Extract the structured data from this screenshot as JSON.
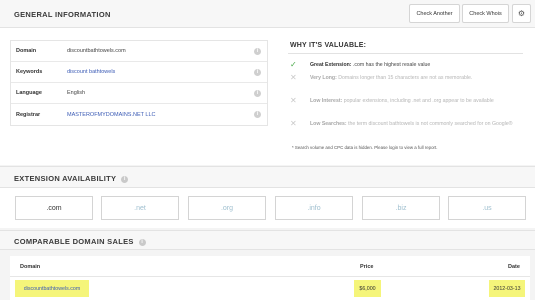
{
  "general": {
    "title": "GENERAL INFORMATION",
    "check_another": "Check Another",
    "check_whois": "Check Whois",
    "rows": [
      {
        "key": "Domain",
        "value": "discountbathtowels.com"
      },
      {
        "key": "Keywords",
        "value": "discount bathtowels"
      },
      {
        "key": "Language",
        "value": "English"
      },
      {
        "key": "Registrar",
        "value": "MASTEROFMYDOMAINS.NET LLC"
      }
    ]
  },
  "why": {
    "title": "WHY IT'S VALUABLE:",
    "items": [
      {
        "status": "ok",
        "label": "Great Extension:",
        "text": ".com has the highest resale value"
      },
      {
        "status": "no",
        "label": "Very Long:",
        "text": "Domains longer than 15 characters are not as memorable."
      },
      {
        "status": "no",
        "label": "Low Interest:",
        "text": "popular extensions, including .net and .org appear to be available"
      },
      {
        "status": "no",
        "label": "Low Searches:",
        "text": "the term discount bathtowels is not commonly searched for on Google®"
      }
    ],
    "note": "* Search volume and CPC data is hidden. Please login to view a full report."
  },
  "extensions": {
    "title": "EXTENSION AVAILABILITY",
    "items": [
      {
        "label": ".com",
        "taken": true
      },
      {
        "label": ".net",
        "taken": false
      },
      {
        "label": ".org",
        "taken": false
      },
      {
        "label": ".info",
        "taken": false
      },
      {
        "label": ".biz",
        "taken": false
      },
      {
        "label": ".us",
        "taken": false
      }
    ]
  },
  "sales": {
    "title": "COMPARABLE DOMAIN SALES",
    "columns": {
      "domain": "Domain",
      "price": "Price",
      "date": "Date"
    },
    "rows": [
      {
        "domain": "discountbathtowels.com",
        "price": "$6,000",
        "date": "2012-03-13"
      }
    ]
  },
  "colors": {
    "highlight": "#f5f57a",
    "check": "#4caa4c",
    "link": "#3b5bb5"
  },
  "icons": {
    "settings": "gear-icon",
    "info": "info-icon"
  }
}
